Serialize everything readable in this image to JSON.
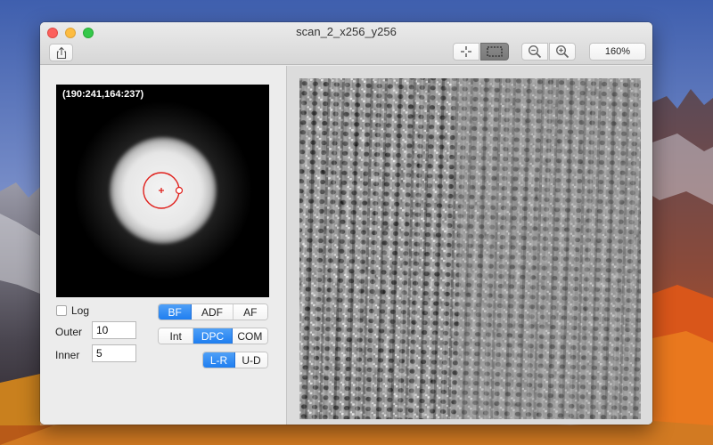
{
  "window": {
    "title": "scan_2_x256_y256"
  },
  "toolbar": {
    "share_icon": "share-icon",
    "crosshair_icon": "crosshair-icon",
    "select_icon": "rectangle-select-icon",
    "zoom_out_icon": "zoom-out-icon",
    "zoom_in_icon": "zoom-in-icon",
    "zoom_level": "160%"
  },
  "detector": {
    "coordinates": "(190:241,164:237)"
  },
  "controls": {
    "log_label": "Log",
    "log_checked": false,
    "outer_label": "Outer",
    "outer_value": "10",
    "inner_label": "Inner",
    "inner_value": "5",
    "mode_options": [
      "BF",
      "ADF",
      "AF"
    ],
    "mode_selected": "BF",
    "signal_options": [
      "Int",
      "DPC",
      "COM"
    ],
    "signal_selected": "DPC",
    "direction_options": [
      "L-R",
      "U-D"
    ],
    "direction_selected": "L-R"
  },
  "colors": {
    "accent": "#1f7ef0",
    "ring": "#e0201c"
  }
}
